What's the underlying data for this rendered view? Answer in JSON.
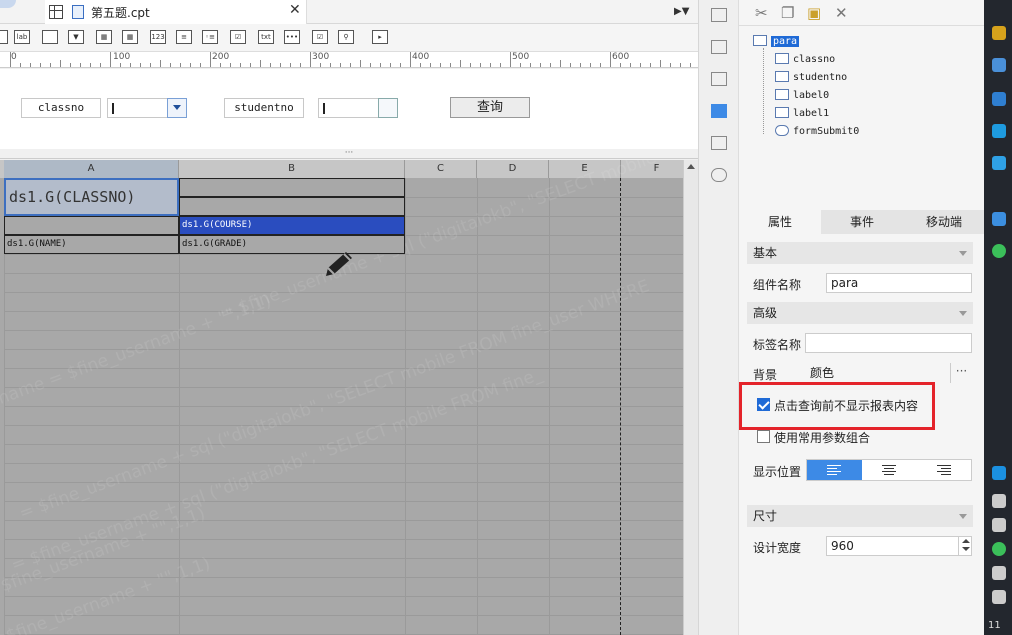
{
  "tab": {
    "title": "第五题.cpt"
  },
  "ruler": {
    "labels": [
      "0",
      "100",
      "200",
      "300",
      "400",
      "500",
      "600"
    ]
  },
  "parameter_panel": {
    "label_classno": "classno",
    "label_studentno": "studentno",
    "query_button": "查询",
    "splitter": "···"
  },
  "grid": {
    "columns": [
      "A",
      "B",
      "C",
      "D",
      "E",
      "F"
    ],
    "cells": {
      "a1": "ds1.G(CLASSNO)",
      "b2": "ds1.G(COURSE)",
      "a3": "ds1.G(NAME)",
      "b3": "ds1.G(GRADE)"
    },
    "watermarks": [
      "= $fine_username + sql (\"digitaiokb\", \"SELECT mobile FROM fine_user WHERE u",
      "name = $fine_username + \"\",1,1)",
      "= $fine_username + sql (\"digitaiokb\", \"SELECT mobile FROM fine_user WHERE",
      "$fine_username + \"\",1,1)",
      "= $fine_username + sql (\"digitaiokb\", \"SELECT mobile FROM fine_",
      "$fine_username + \"\",1,1)"
    ]
  },
  "widget_tree": {
    "root": "para",
    "children": [
      "classno",
      "studentno",
      "label0",
      "label1",
      "formSubmit0"
    ]
  },
  "panel_tabs": [
    "属性",
    "事件",
    "移动端"
  ],
  "properties": {
    "basic_section": "基本",
    "name_label": "组件名称",
    "name_value": "para",
    "advanced_section": "高级",
    "tag_label": "标签名称",
    "tag_value": "",
    "bg_label": "背景",
    "bg_value": "颜色",
    "bg_more": "···",
    "checkbox_hide_before_query": "点击查询前不显示报表内容",
    "checkbox_hide_before_query_checked": true,
    "checkbox_common_params": "使用常用参数组合",
    "checkbox_common_params_checked": false,
    "position_label": "显示位置",
    "size_section": "尺寸",
    "width_label": "设计宽度",
    "width_value": "960"
  },
  "colors": {
    "accent": "#1f6ad6",
    "highlight_border": "#e4232a",
    "selected_cell": "#2a4dbf",
    "grid_bg": "#a8a8a8"
  },
  "taskbar": {
    "clock_partial": "11"
  }
}
